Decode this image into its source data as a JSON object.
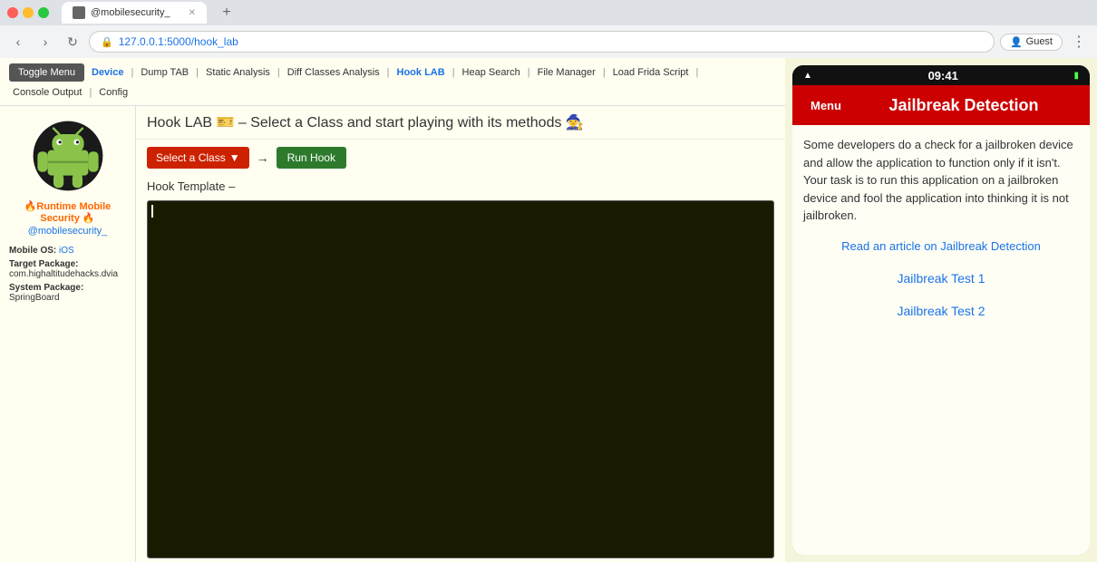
{
  "browser": {
    "tab_title": "@mobilesecurity_",
    "address": "127.0.0.1:5000/hook_lab",
    "guest_label": "Guest"
  },
  "topnav": {
    "toggle_menu_label": "Toggle Menu",
    "links": [
      {
        "label": "Device",
        "active": true
      },
      {
        "label": "Dump TAB"
      },
      {
        "label": "Static Analysis"
      },
      {
        "label": "Diff Classes Analysis"
      },
      {
        "label": "Hook LAB",
        "active": true
      },
      {
        "label": "Heap Search"
      },
      {
        "label": "File Manager"
      },
      {
        "label": "Load Frida Script"
      },
      {
        "label": "Console Output"
      },
      {
        "label": "Config"
      }
    ]
  },
  "page": {
    "title": "Hook LAB 🎫 – Select a Class and start playing with its methods 🧙",
    "select_class_label": "Select a Class",
    "run_hook_label": "Run Hook",
    "hook_template_label": "Hook Template –"
  },
  "sidebar": {
    "title": "🔥Runtime Mobile Security 🔥",
    "username": "@mobilesecurity_",
    "mobile_os_label": "Mobile OS:",
    "mobile_os_value": "iOS",
    "target_pkg_label": "Target Package:",
    "target_pkg_value": "com.highaltitudehacks.dvia",
    "system_pkg_label": "System Package:",
    "system_pkg_value": "SpringBoard"
  },
  "phone": {
    "time": "09:41",
    "menu_label": "Menu",
    "header_title": "Jailbreak Detection",
    "description": "Some developers do a check for a jailbroken device and allow the application to function only if it isn't. Your task is to run this application on a jailbroken device and fool the application into thinking it is not jailbroken.",
    "article_link": "Read an article on Jailbreak Detection",
    "test1_label": "Jailbreak Test 1",
    "test2_label": "Jailbreak Test 2"
  }
}
